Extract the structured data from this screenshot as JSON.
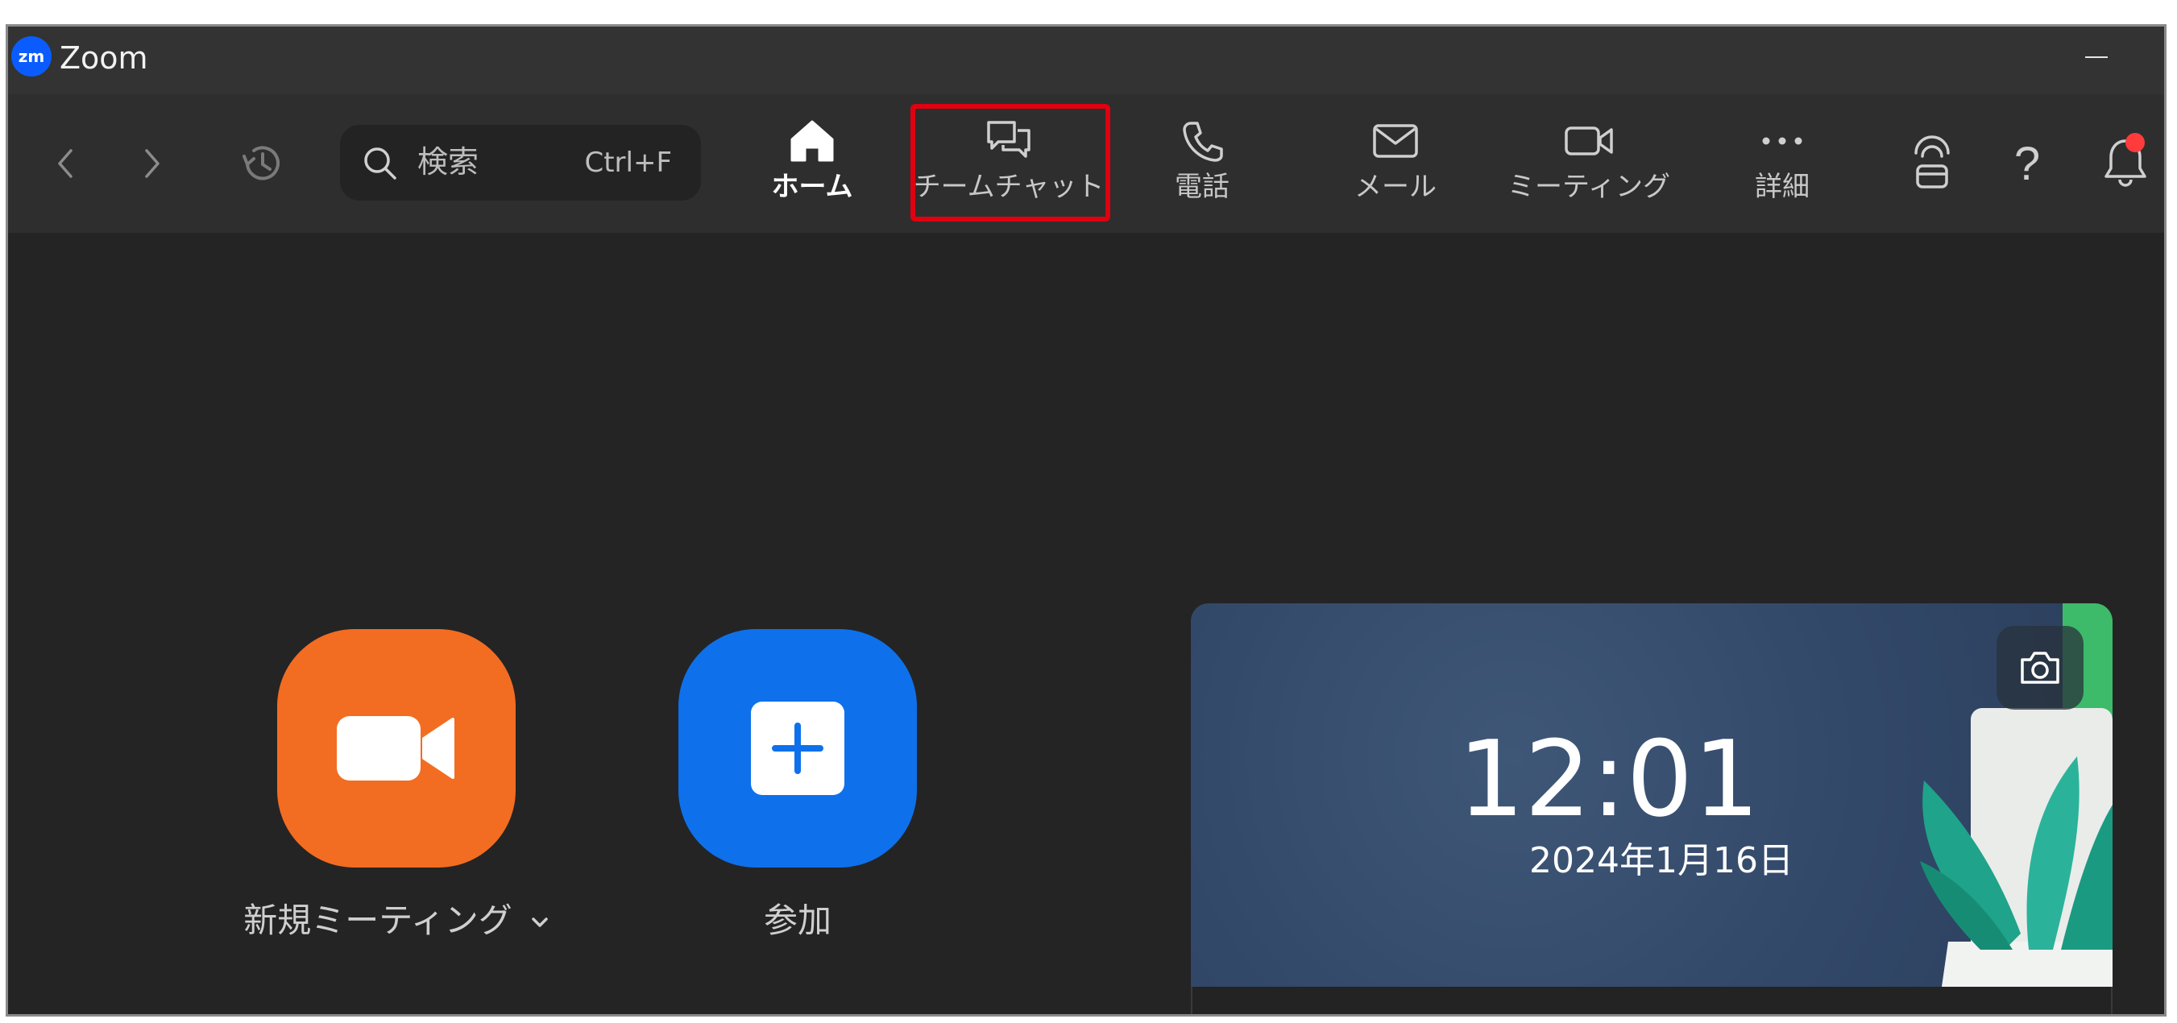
{
  "window": {
    "app_icon_text": "zm",
    "title": "Zoom"
  },
  "toolbar": {
    "search": {
      "placeholder": "検索",
      "shortcut": "Ctrl+F"
    },
    "tabs": [
      {
        "label": "ホーム",
        "icon": "home-icon",
        "active": true
      },
      {
        "label": "チームチャット",
        "icon": "chat-icon",
        "active": false,
        "highlighted": true
      },
      {
        "label": "電話",
        "icon": "phone-icon",
        "active": false
      },
      {
        "label": "メール",
        "icon": "mail-icon",
        "active": false
      },
      {
        "label": "ミーティング",
        "icon": "video-icon",
        "active": false
      },
      {
        "label": "詳細",
        "icon": "more-icon",
        "active": false
      }
    ],
    "right_icons": [
      "headset-icon",
      "help-icon",
      "bell-icon"
    ],
    "help_label": "?"
  },
  "home": {
    "actions": [
      {
        "label": "新規ミーティング",
        "color": "#f26d21",
        "icon": "video-camera-icon",
        "has_dropdown": true
      },
      {
        "label": "参加",
        "color": "#0e71eb",
        "icon": "plus-icon",
        "has_dropdown": false
      }
    ],
    "card": {
      "time": "12:01",
      "date": "2024年1月16日"
    }
  },
  "colors": {
    "accent_highlight": "#e0000f",
    "notification": "#ff3b3b"
  }
}
